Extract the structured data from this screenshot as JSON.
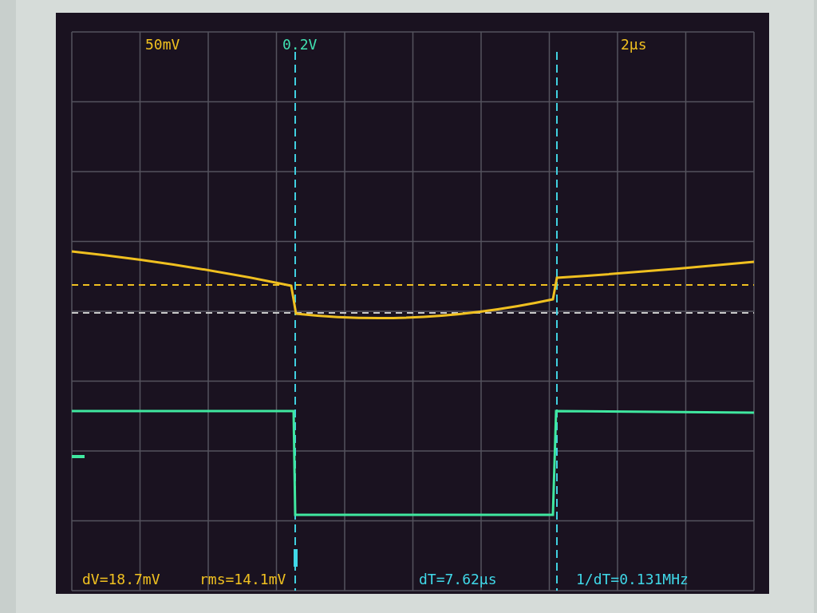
{
  "header": [
    {
      "text": "50mV",
      "color": "#f0c020"
    },
    {
      "text": "0.2V",
      "color": "#40e0b0"
    },
    {
      "text": "2µs",
      "color": "#f0c020"
    }
  ],
  "readouts": [
    {
      "text": "dV=18.7mV",
      "color": "#f0c020"
    },
    {
      "text": "rms=14.1mV",
      "color": "#f0c020"
    },
    {
      "text": "dT=7.62µs",
      "color": "#40d8e8"
    },
    {
      "text": "1/dT=0.131MHz",
      "color": "#40d8e8"
    }
  ]
}
